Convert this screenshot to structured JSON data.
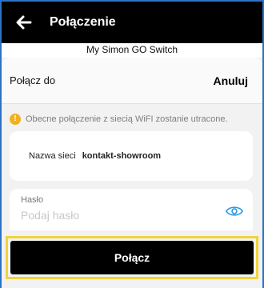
{
  "header": {
    "title": "Połączenie",
    "back_icon": "arrow-left-icon"
  },
  "device_name": "My Simon GO Switch",
  "sheet": {
    "title": "Połącz do",
    "cancel_label": "Anuluj",
    "warning": {
      "icon": "exclamation-icon",
      "text": "Obecne połączenie z siecią WiFI zostanie utracone."
    },
    "network": {
      "label": "Nazwa sieci",
      "value": "kontakt-showroom"
    },
    "password": {
      "label": "Hasło",
      "placeholder": "Podaj hasło",
      "value": "",
      "toggle_icon": "eye-icon"
    },
    "connect_label": "Połącz"
  },
  "colors": {
    "header_bg": "#000000",
    "accent_blue": "#2b9be0",
    "warning_yellow": "#f2b01e",
    "focus_outline": "#f0d33c"
  }
}
